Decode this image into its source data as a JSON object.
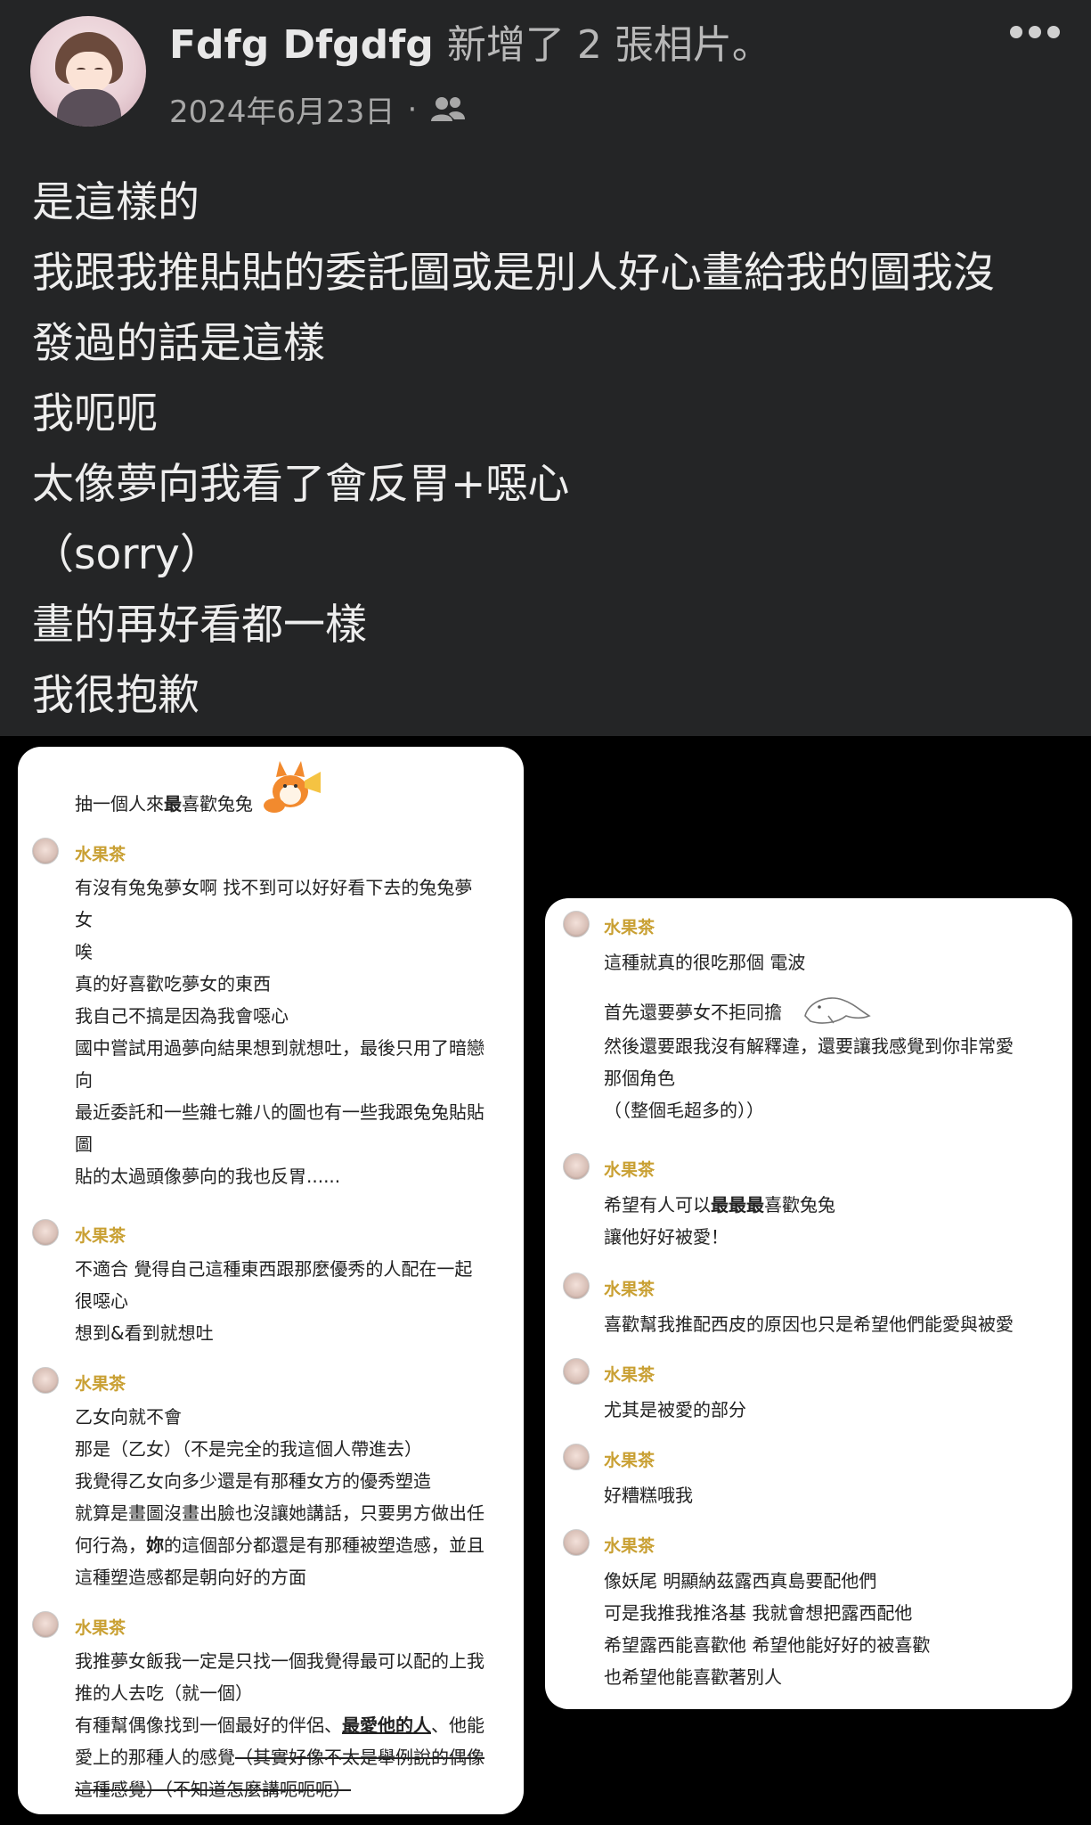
{
  "post": {
    "author": "Fdfg Dfgdfg",
    "action": "新增了 2 張相片。",
    "date": "2024年6月23日",
    "separator": "·",
    "audience_icon": "friends-icon",
    "more_icon": "more-icon",
    "text_lines": [
      "是這樣的",
      "我跟我推貼貼的委託圖或是別人好心畫給我的圖我沒",
      "發過的話是這樣",
      "我呃呃",
      "太像夢向我看了會反胃+噁心",
      "（sorry）",
      "畫的再好看都一樣",
      "我很抱歉"
    ]
  },
  "photo_left": {
    "heading": "抽一個人來最喜歡兔兔",
    "heading_prefix": "抽一個人來",
    "heading_bold": "最",
    "heading_suffix": "喜歡兔兔",
    "username": "水果茶",
    "block1": [
      "有沒有兔兔夢女啊 找不到可以好好看下去的兔兔夢",
      "女",
      "唉",
      "真的好喜歡吃夢女的東西",
      "我自己不搞是因為我會噁心",
      "國中嘗試用過夢向結果想到就想吐，最後只用了暗戀",
      "向",
      "最近委託和一些雜七雜八的圖也有一些我跟兔兔貼貼",
      "圖",
      "貼的太過頭像夢向的我也反胃......"
    ],
    "block2": [
      "不適合 覺得自己這種東西跟那麼優秀的人配在一起",
      "很噁心",
      "想到&看到就想吐"
    ],
    "block3": [
      "乙女向就不會",
      "那是（乙女）（不是完全的我這個人帶進去）",
      "我覺得乙女向多少還是有那種女方的優秀塑造",
      "就算是畫圖沒畫出臉也沒讓她講話，只要男方做出任",
      "何行為，",
      "妳",
      "的這個部分都還是有那種被塑造感，並且",
      "這種塑造感都是朝向好的方面"
    ],
    "block4": [
      "我推夢女飯我一定是只找一個我覺得最可以配的上我",
      "推的人去吃（就一個）",
      "有種幫偶像找到一個最好的伴侶、",
      "最愛他的人",
      "、他能",
      "愛上的那種人的感覺",
      "（其實好像不太是舉例說的偶像",
      "這種感覺）（不知道怎麼講呃呃呃）"
    ]
  },
  "photo_right": {
    "username": "水果茶",
    "block1": [
      "這種就真的很吃那個 電波",
      "首先還要夢女不拒同擔",
      "然後還要跟我沒有解釋違，還要讓我感覺到你非常愛",
      "那個角色",
      "（（整個毛超多的））"
    ],
    "block2_prefix": "希望有人可以",
    "block2_bold": "最最最",
    "block2_suffix": "喜歡兔兔",
    "block2_line2": "讓他好好被愛！",
    "block3": "喜歡幫我推配西皮的原因也只是希望他們能愛與被愛",
    "block4": "尤其是被愛的部分",
    "block5": "好糟糕哦我",
    "block6": [
      "像妖尾 明顯納茲露西真島要配他們",
      "可是我推我推洛基 我就會想把露西配他",
      "希望露西能喜歡他 希望他能好好的被喜歡",
      "也希望他能喜歡著別人"
    ]
  },
  "colors": {
    "post_bg": "#242526",
    "page_bg": "#000000",
    "username_gold": "#c9a033"
  }
}
